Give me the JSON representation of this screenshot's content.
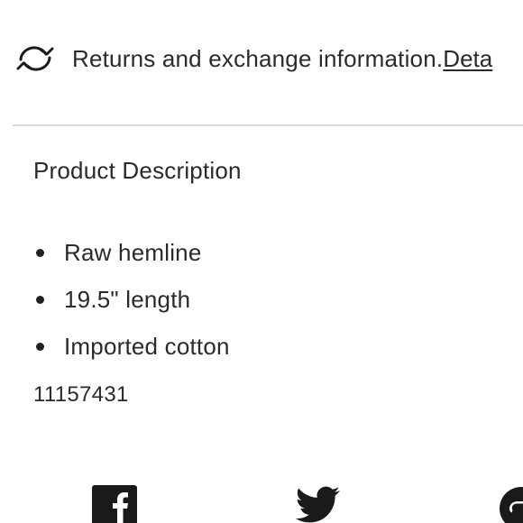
{
  "returns": {
    "icon": "refresh-arrows-icon",
    "text": "Returns and exchange information.",
    "link_label": "Deta"
  },
  "product_description": {
    "title": "Product Description",
    "bullets": [
      "Raw hemline",
      "19.5\" length",
      "Imported cotton"
    ],
    "sku": "11157431"
  },
  "share": {
    "icons": [
      "facebook-icon",
      "twitter-icon",
      "pinterest-icon"
    ],
    "icon_color": "#1a1a1a"
  },
  "colors": {
    "text": "#2a2a2a",
    "divider": "#d9d9d9",
    "background": "#ffffff"
  }
}
